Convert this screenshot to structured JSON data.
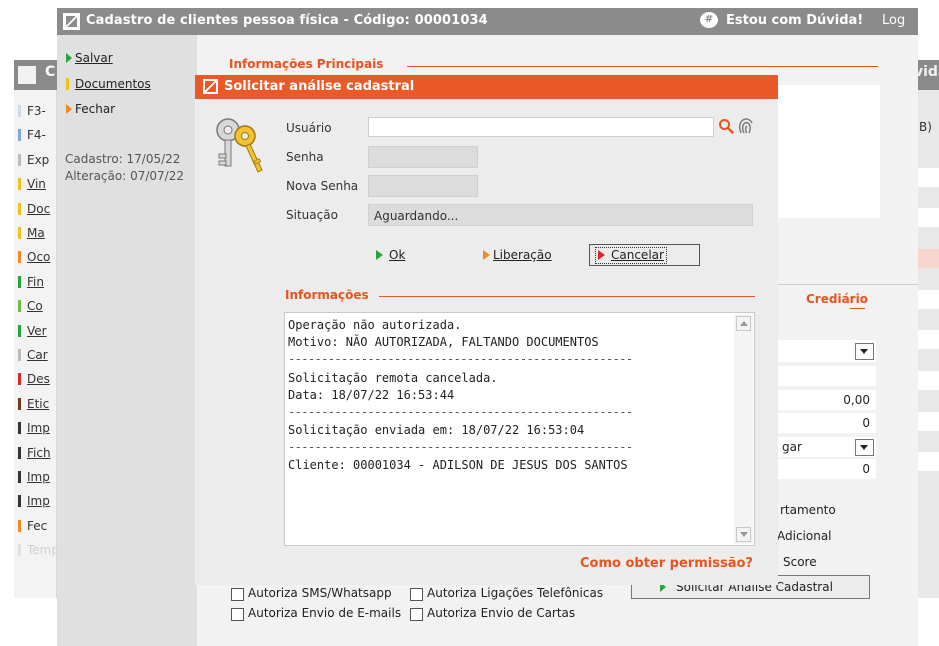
{
  "background_window": {
    "title_fragment": "C",
    "title_right_fragment": "vida",
    "side_items": [
      {
        "label": "F3-",
        "bar": "#cfd9e8"
      },
      {
        "label": "F4-",
        "bar": "#7aaad8"
      },
      {
        "label": "Exp",
        "bar": "#bbbbbb"
      },
      {
        "label": "Vin",
        "bar": "#f3c21a"
      },
      {
        "label": "Doc",
        "bar": "#f3c21a"
      },
      {
        "label": "Ma",
        "bar": "#f3c21a"
      },
      {
        "label": "Oco",
        "bar": "#f08a22"
      },
      {
        "label": "Fin",
        "bar": "#27a43a"
      },
      {
        "label": "Co",
        "bar": "#6cc04a"
      },
      {
        "label": "Ver",
        "bar": "#27a43a"
      },
      {
        "label": "Car",
        "bar": "#bbbbbb"
      },
      {
        "label": "Des",
        "bar": "#d8282a"
      },
      {
        "label": "Etic",
        "bar": "#6b3a1f"
      },
      {
        "label": "Imp",
        "bar": "#333333"
      },
      {
        "label": "Fich",
        "bar": "#333333"
      },
      {
        "label": "Imp",
        "bar": "#333333"
      },
      {
        "label": "Imp",
        "bar": "#333333"
      },
      {
        "label": "Fec",
        "bar": "#f08a22"
      },
      {
        "label": "Temp",
        "bar": "#e0e0e0"
      }
    ],
    "right_fragment": "B)"
  },
  "main_window": {
    "title": "Cadastro de clientes pessoa física - Código: 00001034",
    "help_icon": "hash-chat-icon",
    "help_label": "Estou com Dúvida!",
    "log_label": "Log",
    "sidebar": {
      "salvar": "Salvar",
      "documentos": "Documentos",
      "fechar": "Fechar",
      "cadastro": "Cadastro: 17/05/22",
      "alteracao": "Alteração: 07/07/22"
    },
    "section_title": "Informações Principais",
    "crediario_title": "Crediário",
    "values": [
      "0,00",
      "0",
      "gar",
      "0"
    ],
    "options": [
      "rtamento",
      "Adicional",
      "Score"
    ],
    "solicitar_button": "Solicitar Análise Cadastral",
    "checkboxes": [
      {
        "label": "Autoriza SMS/Whatsapp",
        "checked": false
      },
      {
        "label": "Autoriza Ligações Telefônicas",
        "checked": false
      },
      {
        "label": "Autoriza Envio de E-mails",
        "checked": false
      },
      {
        "label": "Autoriza Envio de Cartas",
        "checked": false
      }
    ],
    "permission_link": "Como obter permissão?"
  },
  "dialog": {
    "title": "Solicitar análise cadastral",
    "icon": "keys-icon",
    "usuario_label": "Usuário",
    "usuario_value": "",
    "senha_label": "Senha",
    "nova_senha_label": "Nova Senha",
    "situacao_label": "Situação",
    "situacao_value": "Aguardando...",
    "buttons": {
      "ok": "Ok",
      "liberacao": "Liberação",
      "cancelar": "Cancelar"
    },
    "info_title": "Informações",
    "info_lines": [
      "Operação não autorizada.",
      "Motivo: NÃO AUTORIZADA, FALTANDO DOCUMENTOS",
      "----------------------------------------------------",
      "Solicitação remota cancelada.",
      "Data: 18/07/22 16:53:44",
      "----------------------------------------------------",
      "Solicitação enviada em: 18/07/22 16:53:04",
      "----------------------------------------------------",
      "Cliente: 00001034 - ADILSON DE JESUS DOS SANTOS"
    ]
  },
  "colors": {
    "accent": "#ea5a29",
    "title_gray": "#8b8b8b"
  }
}
